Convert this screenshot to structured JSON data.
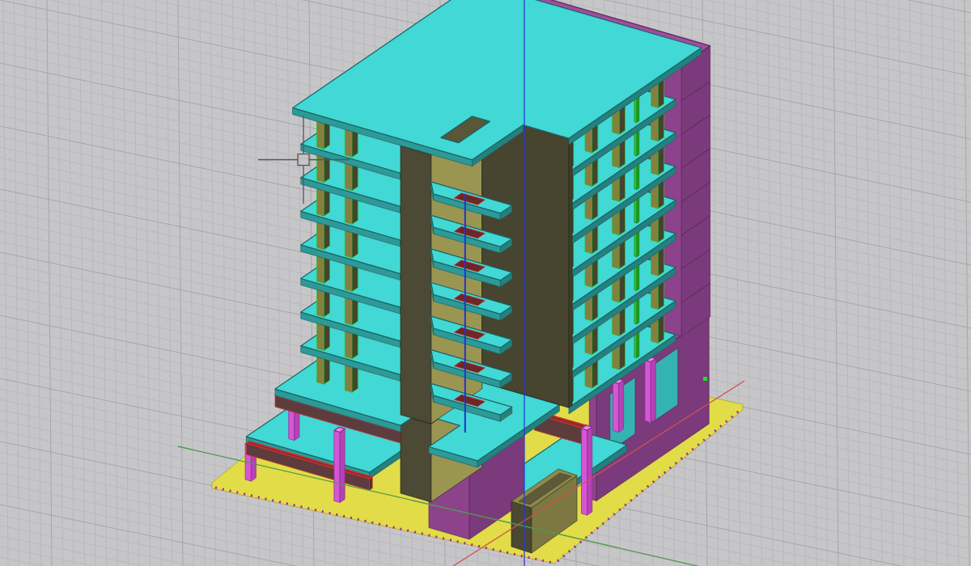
{
  "viewport": {
    "grid": true,
    "axes": true,
    "crosshair": true
  }
}
